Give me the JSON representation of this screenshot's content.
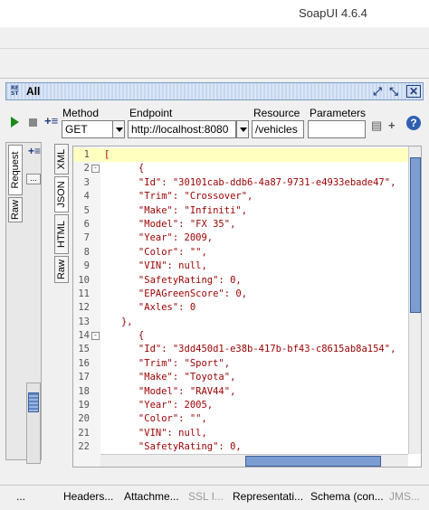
{
  "window": {
    "title": "SoapUI 4.6.4"
  },
  "panel": {
    "badge": "RE\nST",
    "title": "All",
    "buttons": {
      "detach": "⤢",
      "maximize": "⤡",
      "close": "✕"
    }
  },
  "toolbar": {
    "method_label": "Method",
    "method_value": "GET",
    "endpoint_label": "Endpoint",
    "endpoint_value": "http://localhost:8080",
    "resource_label": "Resource",
    "resource_value": "/vehicles",
    "parameters_label": "Parameters",
    "parameters_value": "",
    "add_label": "+",
    "help_label": "?"
  },
  "left_tabs": {
    "request": "Request",
    "raw": "Raw",
    "more": "..."
  },
  "view_tabs": [
    "XML",
    "JSON",
    "HTML",
    "Raw"
  ],
  "editor": {
    "lines": [
      {
        "n": "1",
        "fold": "",
        "text": "["
      },
      {
        "n": "2",
        "fold": "-",
        "text": "      {"
      },
      {
        "n": "3",
        "fold": "",
        "text": "      \"Id\": \"30101cab-ddb6-4a87-9731-e4933ebade47\","
      },
      {
        "n": "4",
        "fold": "",
        "text": "      \"Trim\": \"Crossover\","
      },
      {
        "n": "5",
        "fold": "",
        "text": "      \"Make\": \"Infiniti\","
      },
      {
        "n": "6",
        "fold": "",
        "text": "      \"Model\": \"FX 35\","
      },
      {
        "n": "7",
        "fold": "",
        "text": "      \"Year\": 2009,"
      },
      {
        "n": "8",
        "fold": "",
        "text": "      \"Color\": \"\","
      },
      {
        "n": "9",
        "fold": "",
        "text": "      \"VIN\": null,"
      },
      {
        "n": "10",
        "fold": "",
        "text": "      \"SafetyRating\": 0,"
      },
      {
        "n": "11",
        "fold": "",
        "text": "      \"EPAGreenScore\": 0,"
      },
      {
        "n": "12",
        "fold": "",
        "text": "      \"Axles\": 0"
      },
      {
        "n": "13",
        "fold": "",
        "text": "   },"
      },
      {
        "n": "14",
        "fold": "-",
        "text": "      {"
      },
      {
        "n": "15",
        "fold": "",
        "text": "      \"Id\": \"3dd450d1-e38b-417b-bf43-c8615ab8a154\","
      },
      {
        "n": "16",
        "fold": "",
        "text": "      \"Trim\": \"Sport\","
      },
      {
        "n": "17",
        "fold": "",
        "text": "      \"Make\": \"Toyota\","
      },
      {
        "n": "18",
        "fold": "",
        "text": "      \"Model\": \"RAV44\","
      },
      {
        "n": "19",
        "fold": "",
        "text": "      \"Year\": 2005,"
      },
      {
        "n": "20",
        "fold": "",
        "text": "      \"Color\": \"\","
      },
      {
        "n": "21",
        "fold": "",
        "text": "      \"VIN\": null,"
      },
      {
        "n": "22",
        "fold": "",
        "text": "      \"SafetyRating\": 0,"
      }
    ]
  },
  "bottom_tabs": {
    "more": "...",
    "headers": "Headers...",
    "attachments": "Attachme...",
    "ssl": "SSL I...",
    "representations": "Representati...",
    "schema": "Schema (con...",
    "jms": "JMS..."
  },
  "colors": {
    "code_text": "#9a0000",
    "current_line": "#ffffc0",
    "scroll_thumb": "#7d9dd2"
  }
}
